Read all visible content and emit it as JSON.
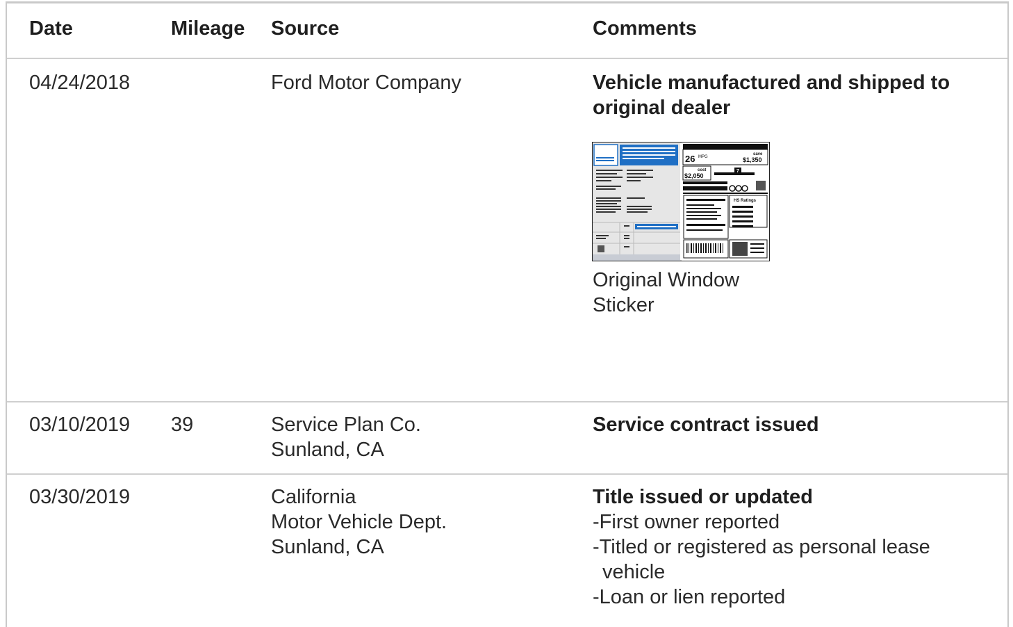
{
  "table": {
    "headers": {
      "date": "Date",
      "mileage": "Mileage",
      "source": "Source",
      "comments": "Comments"
    },
    "rows": [
      {
        "date": "04/24/2018",
        "mileage": "",
        "source": [
          "Ford Motor Company"
        ],
        "comment_title": [
          "Vehicle manufactured and shipped to",
          "original dealer"
        ],
        "sticker": {
          "caption": [
            "Original Window",
            "Sticker"
          ],
          "mpg": "26",
          "mpg_unit": "MPG",
          "save_label": "save",
          "save_amount": "$1,350",
          "cost_label": "cost",
          "cost_amount": "$2,050",
          "rating": "7",
          "ratings_label": "HS Ratings"
        }
      },
      {
        "date": "03/10/2019",
        "mileage": "39",
        "source": [
          "Service Plan Co.",
          "Sunland, CA"
        ],
        "comment_title": [
          "Service contract issued"
        ]
      },
      {
        "date": "03/30/2019",
        "mileage": "",
        "source": [
          "California",
          "Motor Vehicle Dept.",
          "Sunland, CA"
        ],
        "comment_title": [
          "Title issued or updated"
        ],
        "bullets": [
          "First owner reported",
          "Titled or registered as personal lease vehicle",
          "Loan or lien reported"
        ]
      }
    ]
  },
  "colors": {
    "border": "#cfcfcf",
    "sticker_blue": "#1f6fc4",
    "text": "#212121"
  }
}
